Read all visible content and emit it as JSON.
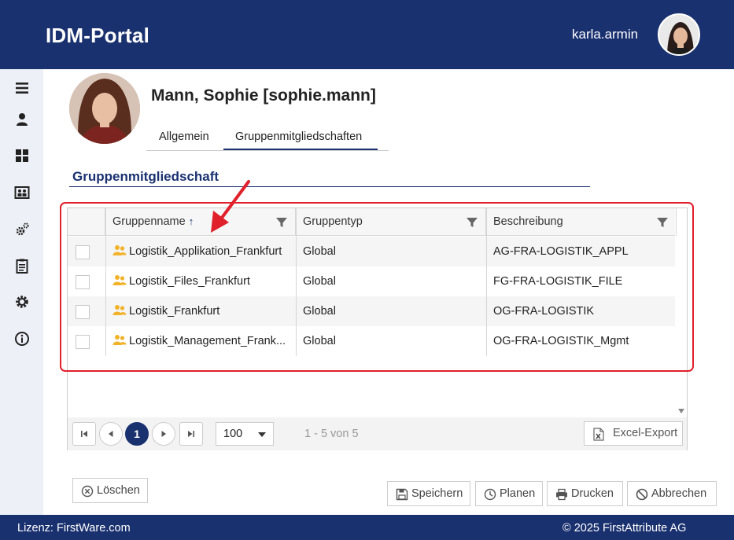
{
  "header": {
    "app_title": "IDM-Portal",
    "username": "karla.armin"
  },
  "sidebar": {
    "items": [
      {
        "icon": "menu-icon"
      },
      {
        "icon": "user-icon"
      },
      {
        "icon": "dashboard-icon"
      },
      {
        "icon": "contacts-icon"
      },
      {
        "icon": "settings-gears-icon"
      },
      {
        "icon": "clipboard-icon"
      },
      {
        "icon": "gear-icon"
      },
      {
        "icon": "info-icon"
      }
    ]
  },
  "profile": {
    "name": "Mann, Sophie [sophie.mann]"
  },
  "tabs": [
    {
      "label": "Allgemein",
      "active": false
    },
    {
      "label": "Gruppenmitgliedschaften",
      "active": true
    }
  ],
  "section": {
    "title": "Gruppenmitgliedschaft"
  },
  "grid": {
    "columns": [
      {
        "label": "Gruppenname",
        "sort": "ascending"
      },
      {
        "label": "Gruppentyp"
      },
      {
        "label": "Beschreibung"
      }
    ],
    "rows": [
      {
        "name": "Logistik_Applikation_Frankfurt",
        "type": "Global",
        "description": "AG-FRA-LOGISTIK_APPL"
      },
      {
        "name": "Logistik_Files_Frankfurt",
        "type": "Global",
        "description": "FG-FRA-LOGISTIK_FILE"
      },
      {
        "name": "Logistik_Frankfurt",
        "type": "Global",
        "description": "OG-FRA-LOGISTIK"
      },
      {
        "name": "Logistik_Management_Frank...",
        "type": "Global",
        "description": "OG-FRA-LOGISTIK_Mgmt"
      }
    ]
  },
  "pager": {
    "current_page": "1",
    "page_size": "100",
    "info": "1 - 5 von 5",
    "excel_label": "Excel-Export"
  },
  "actions": {
    "delete": "Löschen",
    "save": "Speichern",
    "plan": "Planen",
    "print": "Drucken",
    "cancel": "Abbrechen"
  },
  "footer": {
    "license": "Lizenz: FirstWare.com",
    "copyright": "© 2025 FirstAttribute AG"
  },
  "colors": {
    "brand": "#1a3170",
    "annotation": "#e0202a",
    "group_icon": "#f2b32a"
  }
}
